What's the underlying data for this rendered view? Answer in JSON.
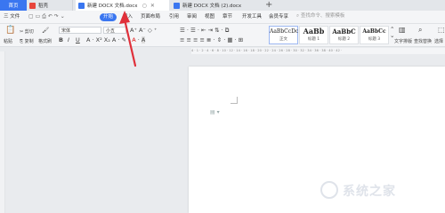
{
  "tabs": {
    "home": "首页",
    "daoke": "稻壳",
    "active_doc": "新建 DOCX 文档.docx",
    "other_doc": "新建 DOCX 文档 (2).docx",
    "new_tab": "+"
  },
  "menu": {
    "file": "三 文件",
    "start": "开始",
    "insert": "插入",
    "page_layout": "页面布局",
    "references": "引用",
    "review": "审阅",
    "view": "视图",
    "chapter": "章节",
    "dev_tools": "开发工具",
    "member": "会员专享",
    "search_placeholder": "查找命令、搜索模板"
  },
  "ribbon": {
    "paste": "粘贴",
    "cut": "剪切",
    "copy": "复制",
    "format_painter": "格式刷",
    "font_name": "宋体",
    "font_size": "小五",
    "styles": [
      {
        "preview": "AaBbCcDc",
        "name": "正文"
      },
      {
        "preview": "AaBb",
        "name": "标题 1"
      },
      {
        "preview": "AaBbC",
        "name": "标题 2"
      },
      {
        "preview": "AaBbCc",
        "name": "标题 3"
      }
    ],
    "text_tools": "文字排版",
    "find_replace": "查找替换",
    "select": "选择"
  },
  "ruler": {
    "ticks": "4 · 1 · 2 · 4 · 6 · 8 · 10 · 12 · 14 · 16 · 18 · 20 · 22 · 24 · 26 · 28 · 30 · 32 · 34 · 36 · 38 · 40 · 42 ·"
  },
  "watermark": "系统之家",
  "colors": {
    "accent": "#3a76f0",
    "arrow": "#e0303a"
  }
}
